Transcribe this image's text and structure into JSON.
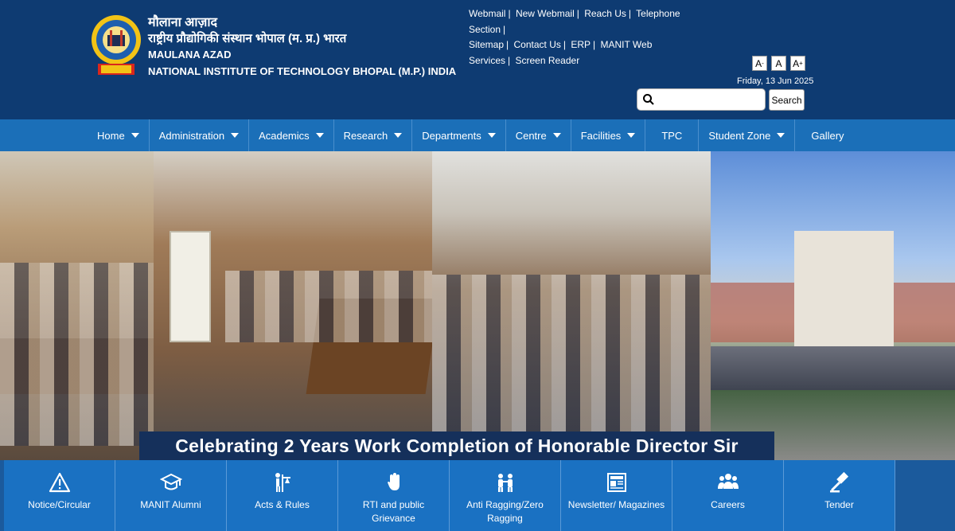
{
  "header": {
    "hindi_line1": "मौलाना आज़ाद",
    "hindi_line2": "राष्ट्रीय प्रौद्योगिकी संस्थान भोपाल (म. प्र.) भारत",
    "english_line1": "MAULANA AZAD",
    "english_line2": "NATIONAL INSTITUTE OF TECHNOLOGY BHOPAL (M.P.) INDIA"
  },
  "top_links": [
    "Webmail",
    "New Webmail",
    "Reach Us",
    "Telephone Section",
    "Sitemap",
    "Contact Us",
    "ERP",
    "MANIT Web Services",
    "Screen Reader"
  ],
  "font_controls": {
    "decrease": "A",
    "normal": "A",
    "increase": "A",
    "minus": "-",
    "plus": "+"
  },
  "date": "Friday, 13 Jun 2025",
  "search": {
    "placeholder": "",
    "button": "Search"
  },
  "nav": [
    {
      "label": "Home",
      "dropdown": true
    },
    {
      "label": "Administration",
      "dropdown": true
    },
    {
      "label": "Academics",
      "dropdown": true
    },
    {
      "label": "Research",
      "dropdown": true
    },
    {
      "label": "Departments",
      "dropdown": true
    },
    {
      "label": "Centre",
      "dropdown": true
    },
    {
      "label": "Facilities",
      "dropdown": true
    },
    {
      "label": "TPC",
      "dropdown": false
    },
    {
      "label": "Student Zone",
      "dropdown": true
    },
    {
      "label": "Gallery",
      "dropdown": false
    }
  ],
  "banner": {
    "caption": "Celebrating 2 Years Work Completion of Honorable Director Sir"
  },
  "tiles": [
    {
      "label": "Notice/Circular",
      "icon": "warning-icon"
    },
    {
      "label": "MANIT Alumni",
      "icon": "graduation-cap-icon"
    },
    {
      "label": "Acts & Rules",
      "icon": "scales-icon"
    },
    {
      "label": "RTI and public Grievance",
      "icon": "hand-icon"
    },
    {
      "label": "Anti Ragging/Zero Ragging",
      "icon": "people-icon"
    },
    {
      "label": "Newsletter/ Magazines",
      "icon": "newspaper-icon"
    },
    {
      "label": "Careers",
      "icon": "group-icon"
    },
    {
      "label": "Tender",
      "icon": "gavel-icon"
    }
  ],
  "colors": {
    "header_bg": "#0e3b72",
    "nav_bg": "#1b6fb8",
    "tile_bg": "#1a71c2",
    "caption_bg": "#15305b"
  }
}
